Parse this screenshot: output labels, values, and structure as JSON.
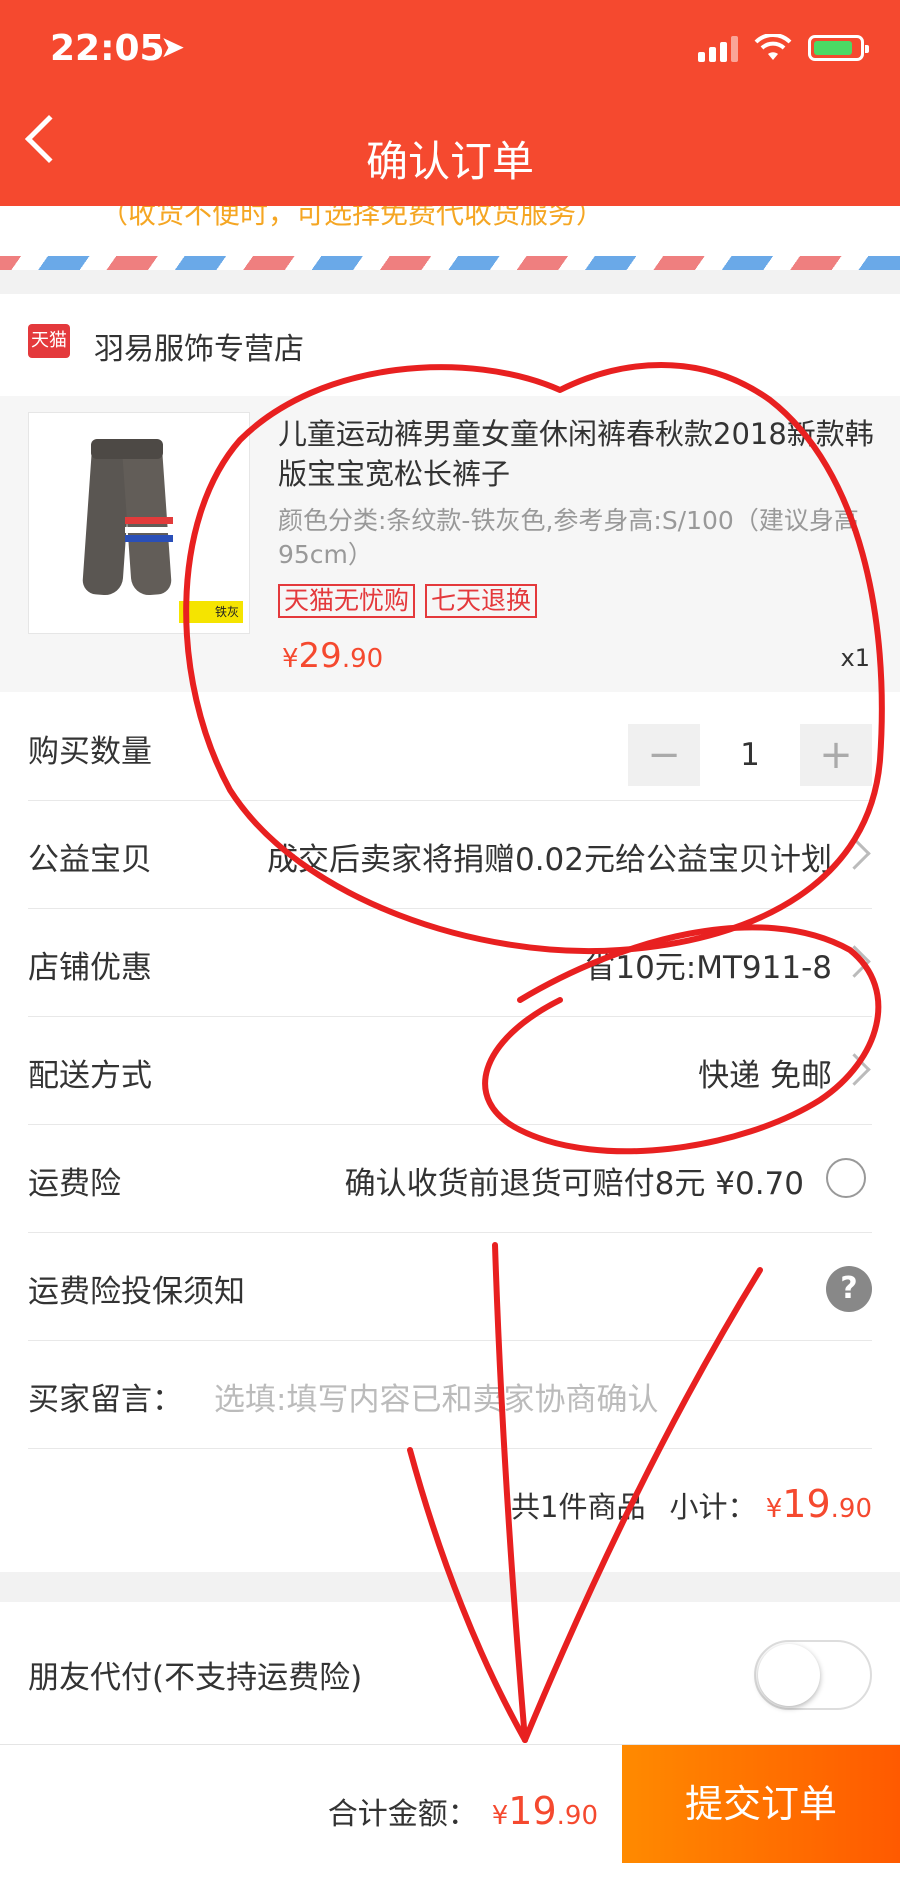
{
  "status_bar": {
    "time": "22:05"
  },
  "header": {
    "title": "确认订单"
  },
  "address_hint": "（收货不便时，可选择免费代收货服务）",
  "shop": {
    "badge": "天猫",
    "name": "羽易服饰专营店"
  },
  "product": {
    "title": "儿童运动裤男童女童休闲裤春秋款2018新款韩版宝宝宽松长裤子",
    "spec": "颜色分类:条纹款-铁灰色,参考身高:S/100（建议身高95cm）",
    "image_tag": "铁灰",
    "tags": [
      "天猫无忧购",
      "七天退换"
    ],
    "price_symbol": "¥",
    "price_int": "29",
    "price_dec": ".90",
    "qty": "x1"
  },
  "rows": {
    "quantity": {
      "label": "购买数量",
      "value": "1",
      "minus": "−",
      "plus": "+"
    },
    "charity": {
      "label": "公益宝贝",
      "value": "成交后卖家将捐赠0.02元给公益宝贝计划"
    },
    "discount": {
      "label": "店铺优惠",
      "value": "省10元:MT911-8"
    },
    "shipping": {
      "label": "配送方式",
      "value": "快递 免邮"
    },
    "insurance": {
      "label": "运费险",
      "value": "确认收货前退货可赔付8元  ¥0.70"
    },
    "insurance_notice": {
      "label": "运费险投保须知",
      "help": "?"
    },
    "message": {
      "label": "买家留言：",
      "placeholder": "选填:填写内容已和卖家协商确认"
    },
    "subtotal": {
      "count_text": "共1件商品",
      "label": "小计：",
      "symbol": "¥",
      "int": "19",
      "dec": ".90"
    }
  },
  "friend_pay": {
    "label": "朋友代付(不支持运费险)"
  },
  "bottom": {
    "total_label": "合计金额：",
    "symbol": "¥",
    "int": "19",
    "dec": ".90",
    "submit": "提交订单"
  },
  "colors": {
    "brand": "#f5492f",
    "submit": "#ff6a00",
    "annotation": "#e82020"
  }
}
